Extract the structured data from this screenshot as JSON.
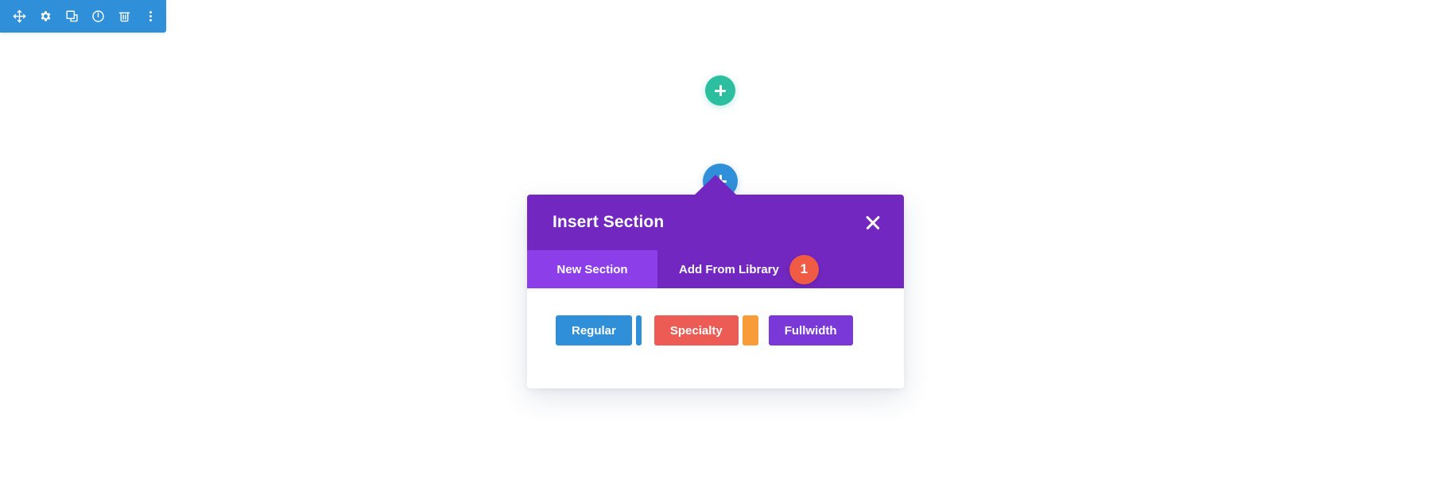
{
  "page": {
    "background_color": "#ffffff"
  },
  "admin_toolbar": {
    "background_color": "#2f8fd8",
    "buttons": [
      {
        "name": "move-icon",
        "label": "Move"
      },
      {
        "name": "gear-icon",
        "label": "Settings"
      },
      {
        "name": "duplicate-icon",
        "label": "Duplicate"
      },
      {
        "name": "power-icon",
        "label": "Disable"
      },
      {
        "name": "trash-icon",
        "label": "Delete"
      },
      {
        "name": "more-options-icon",
        "label": "More Options"
      }
    ]
  },
  "canvas": {
    "add_row_button": {
      "label": "+",
      "name": "add-row-plus-button",
      "color": "#2bbfa0"
    },
    "add_section_button": {
      "label": "+",
      "name": "add-section-plus-button",
      "color": "#2f8fd8"
    }
  },
  "modal": {
    "title": "Insert Section",
    "close_label": "×",
    "header_color": "#7227c0",
    "tabs": [
      {
        "label": "New Section",
        "active": true,
        "badge": null,
        "color": "#8c3ee8"
      },
      {
        "label": "Add From Library",
        "active": false,
        "badge": "1",
        "badge_color": "#ef5b44",
        "color": "#7227c0"
      }
    ],
    "section_types": [
      {
        "label": "Regular",
        "color": "#2f8fd8"
      },
      {
        "label": "Specialty",
        "color": "#ec5c55"
      },
      {
        "label": "Fullwidth",
        "color": "#7b38d8"
      }
    ],
    "accent_strips": [
      {
        "color": "#2f8fd8",
        "width": "thin"
      },
      {
        "color": "#f79c38",
        "width": "wide"
      }
    ]
  }
}
